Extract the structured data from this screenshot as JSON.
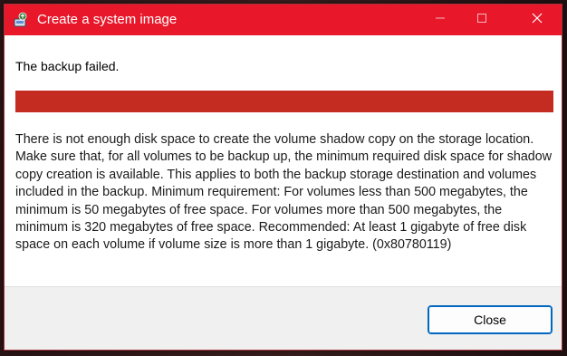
{
  "window": {
    "title": "Create a system image",
    "title_icon": "system-image-backup-icon",
    "accent_color": "#e8172a"
  },
  "titlebar": {
    "minimize_icon": "minimize-icon",
    "maximize_icon": "maximize-icon",
    "close_icon": "close-icon"
  },
  "main": {
    "heading": "The backup failed.",
    "progress": {
      "fraction": 1.0,
      "color": "#c42b21"
    },
    "message": "There is not enough disk space to create the volume shadow copy on the storage location. Make sure that, for all volumes to be backup up, the minimum required disk space for shadow copy creation is available. This applies to both the backup storage destination and volumes included in the backup. Minimum requirement: For volumes less than 500 megabytes, the minimum is 50 megabytes of free space. For volumes more than 500 megabytes, the minimum is 320 megabytes of free space.  Recommended: At least 1 gigabyte of free disk space on each volume if volume size is more than 1 gigabyte. (0x80780119)"
  },
  "footer": {
    "close_label": "Close"
  }
}
